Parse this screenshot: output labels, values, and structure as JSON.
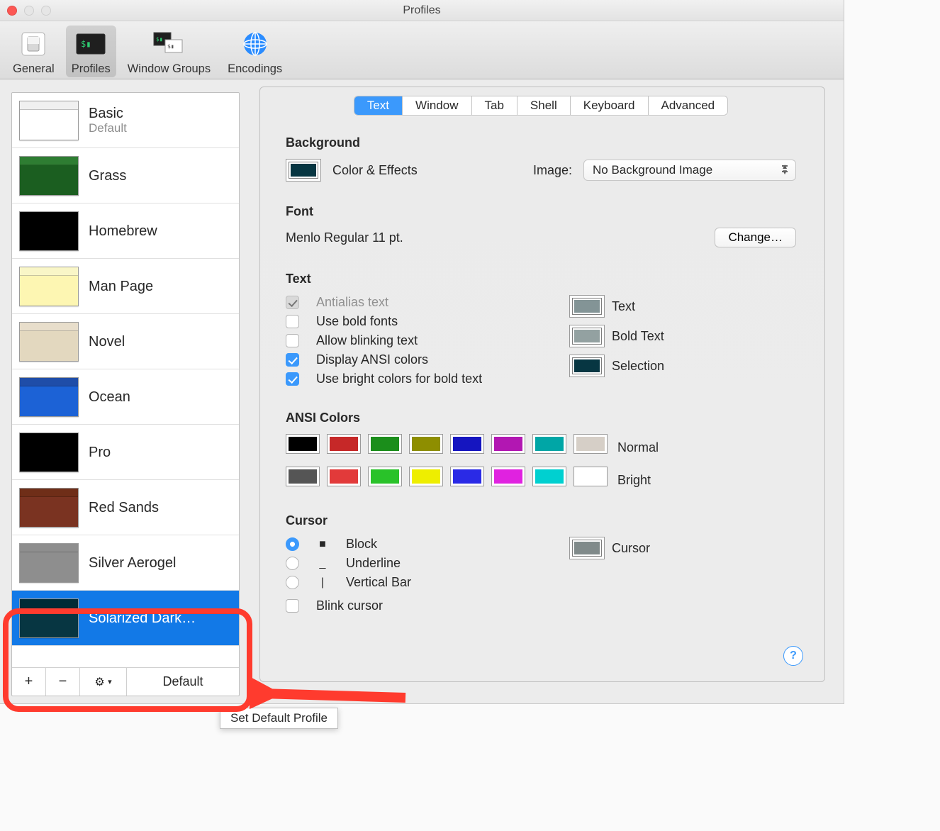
{
  "window": {
    "title": "Profiles"
  },
  "toolbar": {
    "items": [
      {
        "label": "General"
      },
      {
        "label": "Profiles"
      },
      {
        "label": "Window Groups"
      },
      {
        "label": "Encodings"
      }
    ]
  },
  "sidebar": {
    "profiles": [
      {
        "name": "Basic",
        "sub": "Default",
        "thumb": {
          "titlebar": "#f0f0f0",
          "body": "#ffffff"
        }
      },
      {
        "name": "Grass",
        "thumb": {
          "titlebar": "#2e7d32",
          "body": "#1b5e20"
        }
      },
      {
        "name": "Homebrew",
        "thumb": {
          "titlebar": "#000000",
          "body": "#000000"
        }
      },
      {
        "name": "Man Page",
        "thumb": {
          "titlebar": "#f9f6c7",
          "body": "#fdf6b2"
        }
      },
      {
        "name": "Novel",
        "thumb": {
          "titlebar": "#e8decb",
          "body": "#e3d8bf"
        }
      },
      {
        "name": "Ocean",
        "thumb": {
          "titlebar": "#1f4da8",
          "body": "#1c62d6"
        }
      },
      {
        "name": "Pro",
        "thumb": {
          "titlebar": "#000000",
          "body": "#000000"
        }
      },
      {
        "name": "Red Sands",
        "thumb": {
          "titlebar": "#6f2e18",
          "body": "#7a3321"
        }
      },
      {
        "name": "Silver Aerogel",
        "thumb": {
          "titlebar": "#8e8e8e",
          "body": "#8e8e8e"
        }
      },
      {
        "name": "Solarized Dark…",
        "thumb": {
          "titlebar": "#002b36",
          "body": "#073642"
        },
        "selected": true
      }
    ],
    "footer": {
      "add": "+",
      "remove": "−",
      "actions": "⚙︎ ⌄",
      "default_label": "Default"
    },
    "tooltip": "Set Default Profile"
  },
  "tabs": {
    "items": [
      "Text",
      "Window",
      "Tab",
      "Shell",
      "Keyboard",
      "Advanced"
    ],
    "active": "Text"
  },
  "background": {
    "heading": "Background",
    "color_effects": "Color & Effects",
    "color_swatch": "#073642",
    "image_label": "Image:",
    "image_value": "No Background Image"
  },
  "font": {
    "heading": "Font",
    "description": "Menlo Regular 11 pt.",
    "change_label": "Change…"
  },
  "text_section": {
    "heading": "Text",
    "options": [
      {
        "label": "Antialias text",
        "checked": true,
        "disabled": true
      },
      {
        "label": "Use bold fonts",
        "checked": false
      },
      {
        "label": "Allow blinking text",
        "checked": false
      },
      {
        "label": "Display ANSI colors",
        "checked": true
      },
      {
        "label": "Use bright colors for bold text",
        "checked": true
      }
    ],
    "color_labels": {
      "text": "Text",
      "bold": "Bold Text",
      "selection": "Selection"
    },
    "color_values": {
      "text": "#839496",
      "bold": "#93a1a1",
      "selection": "#073642"
    }
  },
  "ansi": {
    "heading": "ANSI Colors",
    "normal_label": "Normal",
    "bright_label": "Bright",
    "normal": [
      "#000000",
      "#c62828",
      "#1b8e1b",
      "#8e8e00",
      "#1515c0",
      "#b217b2",
      "#00a6a6",
      "#d6cfc7"
    ],
    "bright": [
      "#555555",
      "#e23a3a",
      "#29c229",
      "#eeee00",
      "#2a2ae6",
      "#e022e0",
      "#00d0d0",
      "#ffffff"
    ]
  },
  "cursor": {
    "heading": "Cursor",
    "shapes": [
      {
        "glyph": "■",
        "label": "Block",
        "selected": true
      },
      {
        "glyph": "_",
        "label": "Underline"
      },
      {
        "glyph": "|",
        "label": "Vertical Bar"
      }
    ],
    "blink_label": "Blink cursor",
    "color_label": "Cursor",
    "color_value": "#808a8a"
  }
}
